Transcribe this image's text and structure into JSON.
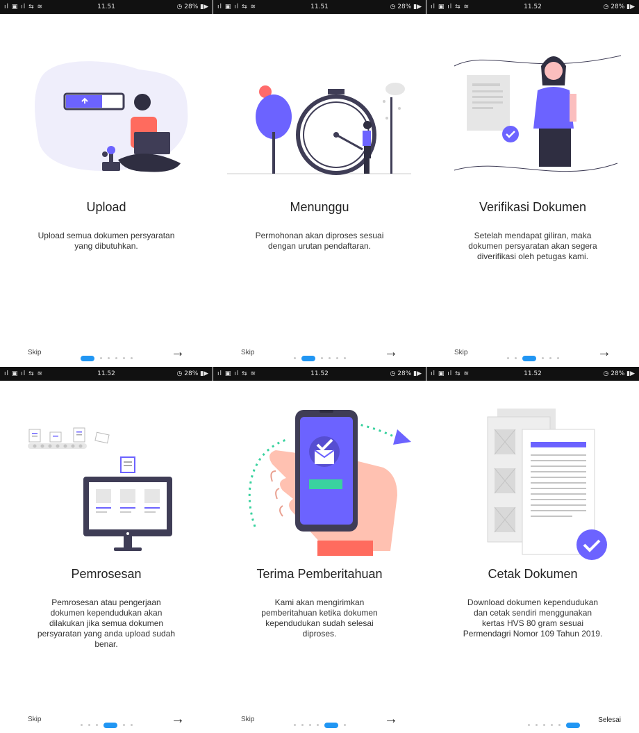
{
  "screens": [
    {
      "status": {
        "left": "ıl ▣ ıl ⇆ ≋",
        "time": "11.51",
        "right": "◷ 28% ▮▶"
      },
      "title": "Upload",
      "desc": "Upload semua dokumen persyaratan\nyang dibutuhkan.",
      "skip": "Skip",
      "arrow": "→",
      "done": "",
      "active_dot": 0
    },
    {
      "status": {
        "left": "ıl ▣ ıl ⇆ ≋",
        "time": "11.51",
        "right": "◷ 28% ▮▶"
      },
      "title": "Menunggu",
      "desc": "Permohonan akan diproses sesuai\ndengan urutan pendaftaran.",
      "skip": "Skip",
      "arrow": "→",
      "done": "",
      "active_dot": 1
    },
    {
      "status": {
        "left": "ıl ▣ ıl ⇆ ≋",
        "time": "11.52",
        "right": "◷ 28% ▮▶"
      },
      "title": "Verifikasi Dokumen",
      "desc": "Setelah mendapat giliran, maka\ndokumen persyaratan akan segera\ndiverifikasi oleh petugas kami.",
      "skip": "Skip",
      "arrow": "→",
      "done": "",
      "active_dot": 2
    },
    {
      "status": {
        "left": "ıl ▣ ıl ⇆ ≋",
        "time": "11.52",
        "right": "◷ 28% ▮▶"
      },
      "title": "Pemrosesan",
      "desc": "Pemrosesan atau pengerjaan\ndokumen kependudukan akan\ndilakukan jika semua dokumen\npersyaratan yang anda upload sudah\nbenar.",
      "skip": "Skip",
      "arrow": "→",
      "done": "",
      "active_dot": 3
    },
    {
      "status": {
        "left": "ıl ▣ ıl ⇆ ≋",
        "time": "11.52",
        "right": "◷ 28% ▮▶"
      },
      "title": "Terima Pemberitahuan",
      "desc": "Kami akan mengirimkan\npemberitahuan ketika dokumen\nkependudukan sudah selesai\ndiproses.",
      "skip": "Skip",
      "arrow": "→",
      "done": "",
      "active_dot": 4
    },
    {
      "status": {
        "left": "ıl ▣ ıl ⇆ ≋",
        "time": "11.52",
        "right": "◷ 28% ▮▶"
      },
      "title": "Cetak Dokumen",
      "desc": "Download dokumen kependudukan\ndan cetak sendiri menggunakan\nkertas HVS 80 gram sesuai\nPermendagri Nomor 109 Tahun 2019.",
      "skip": "",
      "arrow": "",
      "done": "Selesai",
      "active_dot": 5
    }
  ],
  "dot_count": 6,
  "colors": {
    "accent": "#6c63ff",
    "active_dot": "#2196f3",
    "statusbar": "#111111"
  }
}
